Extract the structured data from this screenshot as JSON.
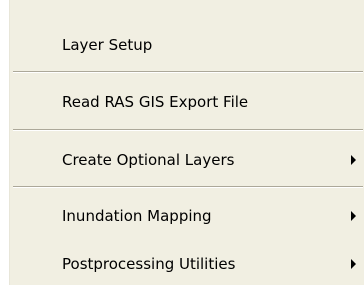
{
  "menu": {
    "items": [
      {
        "label": "Layer Setup",
        "has_submenu": false
      },
      {
        "label": "Read RAS GIS Export File",
        "has_submenu": false
      },
      {
        "label": "Create Optional Layers",
        "has_submenu": true,
        "submenu_icon": "submenu-arrow-icon"
      },
      {
        "label": "Inundation Mapping",
        "has_submenu": true,
        "submenu_icon": "submenu-arrow-icon"
      },
      {
        "label": "Postprocessing Utilities",
        "has_submenu": true,
        "submenu_icon": "submenu-arrow-icon"
      }
    ],
    "colors": {
      "background": "#f1efe2",
      "text": "#000000",
      "separator_dark": "#aca899",
      "separator_light": "#ffffff"
    }
  }
}
